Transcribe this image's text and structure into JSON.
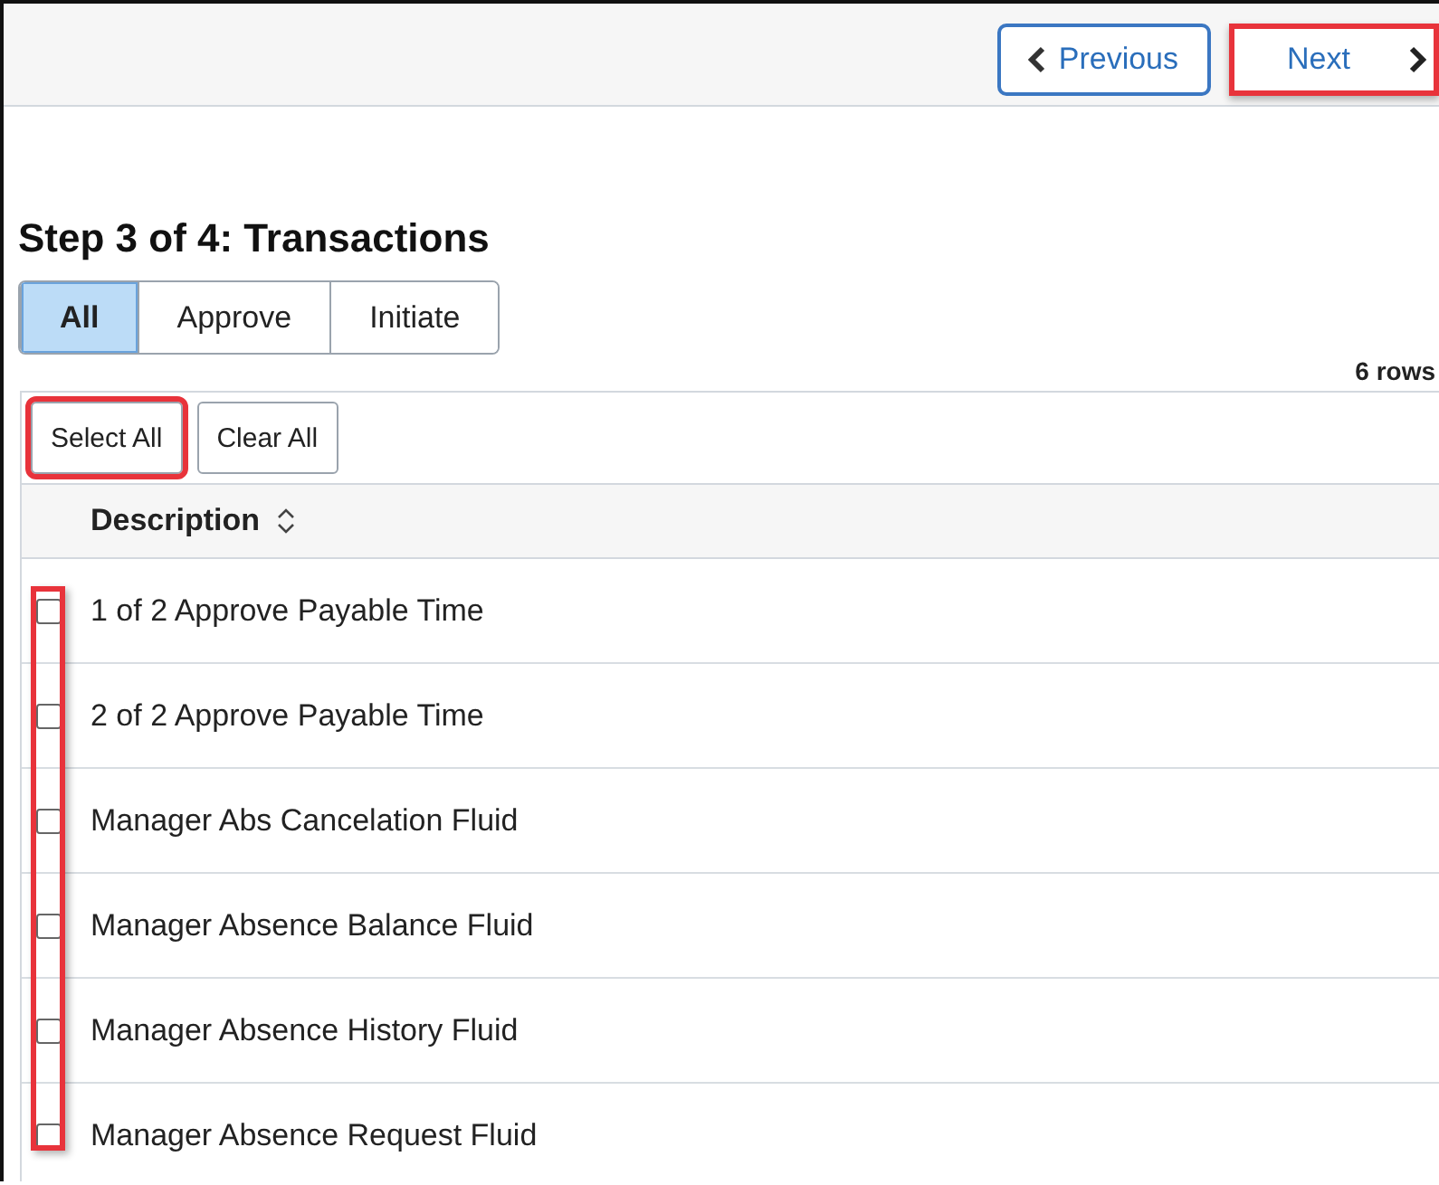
{
  "header": {
    "buttons": [
      {
        "kind": "previous",
        "label": "Previous",
        "highlighted": false
      },
      {
        "kind": "next",
        "label": "Next",
        "highlighted": true
      }
    ]
  },
  "title": "Step 3 of 4: Transactions",
  "tabs": [
    {
      "label": "All",
      "selected": true
    },
    {
      "label": "Approve",
      "selected": false
    },
    {
      "label": "Initiate",
      "selected": false
    }
  ],
  "row_count": "6 rows",
  "toolbar": [
    {
      "label": "Select All",
      "highlighted": true
    },
    {
      "label": "Clear All",
      "highlighted": false
    }
  ],
  "table": {
    "columns": [
      {
        "label": "Description"
      }
    ],
    "checkbox_column_highlighted": true,
    "rows": [
      {
        "description": "1 of 2 Approve Payable Time",
        "checked": false
      },
      {
        "description": "2 of 2 Approve Payable Time",
        "checked": false
      },
      {
        "description": "Manager Abs Cancelation Fluid",
        "checked": false
      },
      {
        "description": "Manager Absence Balance Fluid",
        "checked": false
      },
      {
        "description": "Manager Absence History Fluid",
        "checked": false
      },
      {
        "description": "Manager Absence Request Fluid",
        "checked": false
      }
    ]
  }
}
